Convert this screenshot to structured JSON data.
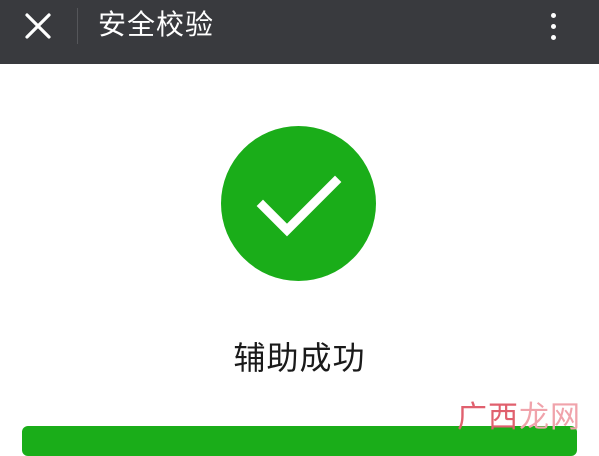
{
  "header": {
    "title": "安全校验",
    "close_icon": "close-icon",
    "more_icon": "more-vertical-icon",
    "background_color": "#393a3e"
  },
  "result": {
    "icon": "check-circle-icon",
    "icon_color": "#1aad19",
    "message": "辅助成功"
  },
  "watermark": {
    "part1": "广西",
    "part2": "龙网"
  }
}
